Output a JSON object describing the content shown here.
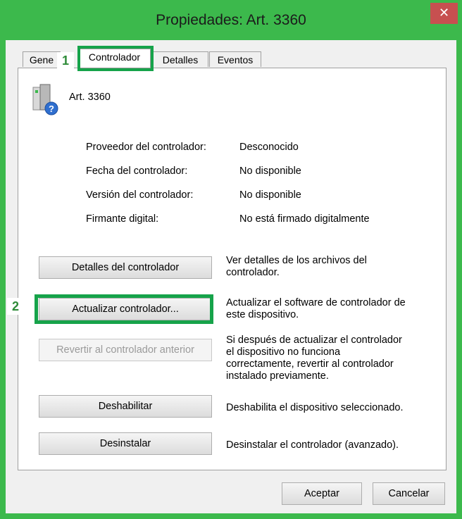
{
  "window": {
    "title": "Propiedades: Art. 3360",
    "close_glyph": "✕"
  },
  "tabs": [
    {
      "label": "Gene"
    },
    {
      "label": "Controlador"
    },
    {
      "label": "Detalles"
    },
    {
      "label": "Eventos"
    }
  ],
  "device": {
    "name": "Art. 3360",
    "icon": "unknown-device-icon"
  },
  "properties": [
    {
      "label": "Proveedor del controlador:",
      "value": "Desconocido"
    },
    {
      "label": "Fecha del controlador:",
      "value": "No disponible"
    },
    {
      "label": "Versión del controlador:",
      "value": "No disponible"
    },
    {
      "label": "Firmante digital:",
      "value": "No está firmado digitalmente"
    }
  ],
  "actions": [
    {
      "button": "Detalles del controlador",
      "desc1": "Ver detalles de los archivos del",
      "desc2": "controlador.",
      "desc3": "",
      "desc4": ""
    },
    {
      "button": "Actualizar controlador...",
      "desc1": "Actualizar el software de controlador de",
      "desc2": "este dispositivo.",
      "desc3": "",
      "desc4": ""
    },
    {
      "button": "Revertir al controlador anterior",
      "desc1": "Si después de actualizar el controlador",
      "desc2": "el dispositivo no funciona",
      "desc3": "correctamente, revertir al controlador",
      "desc4": "instalado previamente."
    },
    {
      "button": "Deshabilitar",
      "desc1": "Deshabilita el dispositivo seleccionado.",
      "desc2": "",
      "desc3": "",
      "desc4": ""
    },
    {
      "button": "Desinstalar",
      "desc1": "Desinstalar el controlador (avanzado).",
      "desc2": "",
      "desc3": "",
      "desc4": ""
    }
  ],
  "footer": {
    "ok": "Aceptar",
    "cancel": "Cancelar"
  },
  "annotations": {
    "step1": "1",
    "step2": "2"
  },
  "colors": {
    "frame": "#3cb94c",
    "highlight": "#16a34a",
    "close": "#c75050"
  }
}
